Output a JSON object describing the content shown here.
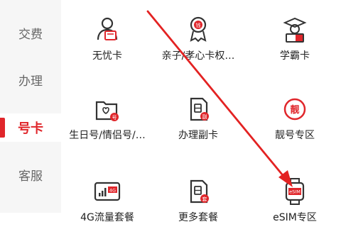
{
  "sidebar": {
    "items": [
      {
        "label": "交费"
      },
      {
        "label": "办理"
      },
      {
        "label": "号卡",
        "active": true
      },
      {
        "label": "客服"
      }
    ]
  },
  "grid": {
    "rows": [
      [
        {
          "label": "无忧卡",
          "icon": "person-card-icon"
        },
        {
          "label": "亲子/孝心卡权…",
          "icon": "badge-icon"
        },
        {
          "label": "学霸卡",
          "icon": "student-icon"
        }
      ],
      [
        {
          "label": "生日号/情侣号/…",
          "icon": "birthday-folder-icon"
        },
        {
          "label": "办理副卡",
          "icon": "sim-card-sub-icon"
        },
        {
          "label": "靓号专区",
          "icon": "pretty-number-icon",
          "badge": "靓"
        }
      ],
      [
        {
          "label": "4G流量套餐",
          "icon": "4g-data-icon",
          "badge": "4G"
        },
        {
          "label": "更多套餐",
          "icon": "sim-card-more-icon"
        },
        {
          "label": "eSIM专区",
          "icon": "esim-watch-icon",
          "badge": "eSIM"
        }
      ]
    ]
  },
  "colors": {
    "accent": "#e0262b",
    "annotation_arrow": "#e32222"
  }
}
